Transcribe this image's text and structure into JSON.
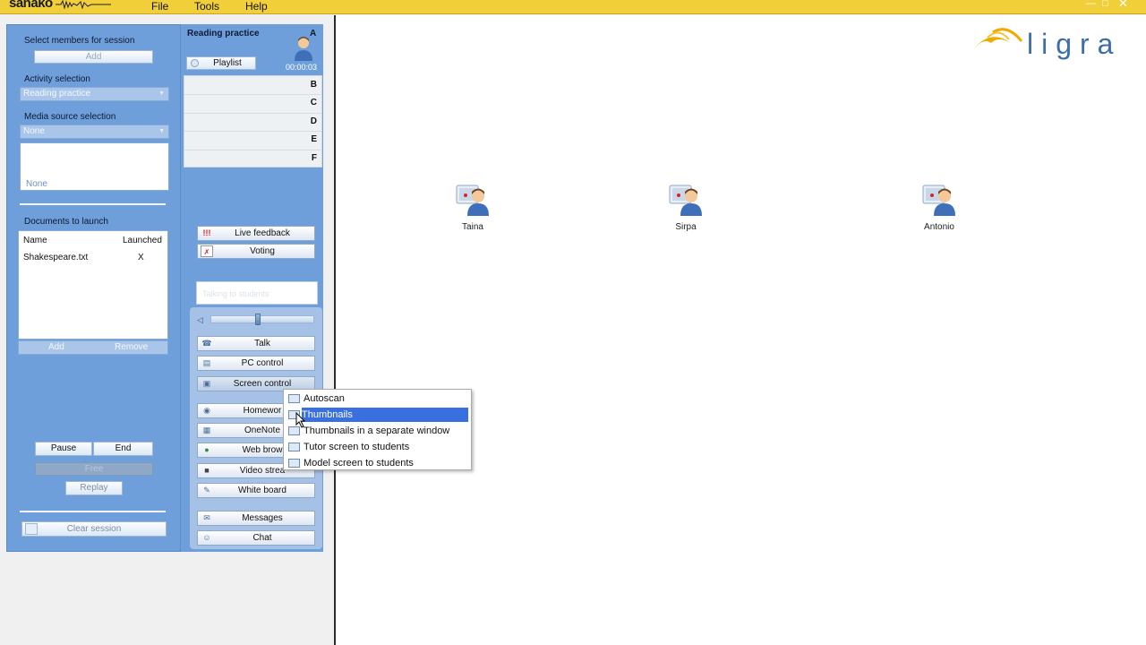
{
  "app": {
    "logo_text": "sanako",
    "menu": [
      "File",
      "Tools",
      "Help"
    ],
    "brand_logo": "ligra",
    "colors": {
      "title_bar": "#f1cf3b",
      "panel_blue": "#6e9fda",
      "selection": "#3a6fe0",
      "logo_orange": "#f2a900",
      "logo_blue": "#3c6fa7"
    }
  },
  "session": {
    "select_members_label": "Select members for session",
    "add_members_button": "Add",
    "activity_label": "Activity selection",
    "activity_value": "Reading practice",
    "media_label": "Media source selection",
    "media_value": "None",
    "media_box_value": "None",
    "documents_label": "Documents to launch",
    "doc_columns": [
      "Name",
      "Launched"
    ],
    "documents": [
      {
        "name": "Shakespeare.txt",
        "launched": "X"
      }
    ],
    "doc_add": "Add",
    "doc_remove": "Remove",
    "pause": "Pause",
    "end": "End",
    "free": "Free",
    "replay": "Replay",
    "clear_session": "Clear session"
  },
  "groups": {
    "active_title": "Reading practice",
    "active_letter": "A",
    "playlist_button": "Playlist",
    "timer": "00:00:03",
    "rows": [
      "B",
      "C",
      "D",
      "E",
      "F"
    ]
  },
  "controls": {
    "live_feedback": "Live feedback",
    "voting": "Voting",
    "talking_to_students": "Talking to students",
    "talk": "Talk",
    "pc_control": "PC control",
    "screen_control": "Screen control",
    "homework": "Homewor",
    "onenote": "OneNote",
    "web_browser": "Web brow",
    "video_stream": "Video strea",
    "white_board": "White board",
    "messages": "Messages",
    "chat": "Chat"
  },
  "context_menu": {
    "items": [
      "Autoscan",
      "Thumbnails",
      "Thumbnails in a separate window",
      "Tutor screen to students",
      "Model screen to students"
    ],
    "selected_index": 1
  },
  "students": [
    "Taina",
    "Sirpa",
    "Antonio"
  ]
}
